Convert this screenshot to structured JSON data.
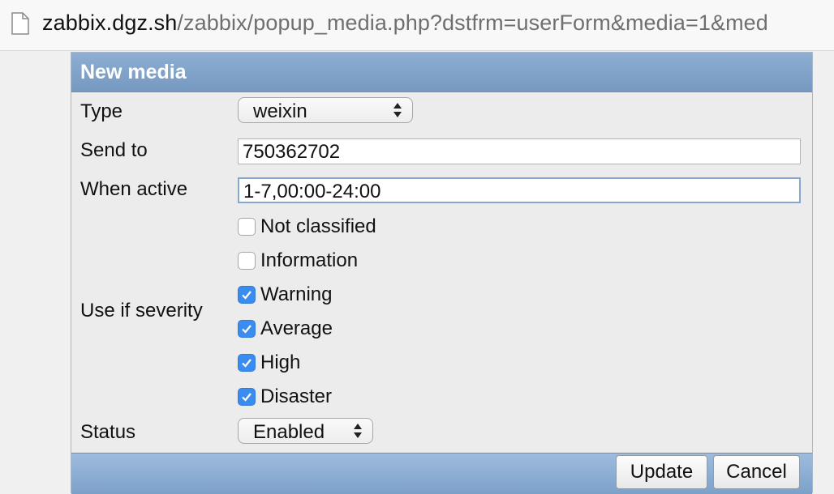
{
  "browser": {
    "url_host": "zabbix.dgz.sh",
    "url_path": "/zabbix/popup_media.php?dstfrm=userForm&media=1&med"
  },
  "dialog": {
    "title": "New media",
    "type_label": "Type",
    "type_value": "weixin",
    "send_to_label": "Send to",
    "send_to_value": "750362702",
    "when_active_label": "When active",
    "when_active_value": "1-7,00:00-24:00",
    "severity_label": "Use if severity",
    "severities": [
      {
        "label": "Not classified",
        "checked": false
      },
      {
        "label": "Information",
        "checked": false
      },
      {
        "label": "Warning",
        "checked": true
      },
      {
        "label": "Average",
        "checked": true
      },
      {
        "label": "High",
        "checked": true
      },
      {
        "label": "Disaster",
        "checked": true
      }
    ],
    "status_label": "Status",
    "status_value": "Enabled",
    "update_label": "Update",
    "cancel_label": "Cancel"
  },
  "colors": {
    "header": "#7e9fc7",
    "checkbox_on": "#3b8cf0"
  }
}
